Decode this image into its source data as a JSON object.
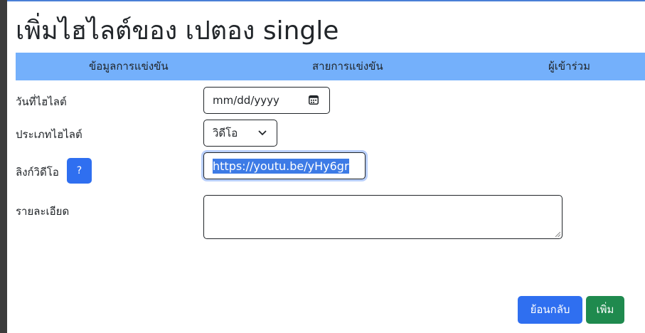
{
  "page": {
    "title": "เพิ่มไฮไลต์ของ เปตอง single"
  },
  "tabs": [
    {
      "label": "ข้อมูลการแข่งขัน"
    },
    {
      "label": "สายการแข่งขัน"
    },
    {
      "label": "ผู้เข้าร่วม"
    }
  ],
  "form": {
    "date_label": "วันที่ไฮไลต์",
    "date_placeholder": "mm/dd/yyyy",
    "type_label": "ประเภทไฮไลต์",
    "type_value": "วิดีโอ",
    "link_label": "ลิงก์วิดีโอ",
    "help_label": "?",
    "link_value": "https://youtu.be/yHy6gr",
    "detail_label": "รายละเอียด",
    "detail_value": ""
  },
  "buttons": {
    "back_label": "ย้อนกลับ",
    "add_label": "เพิ่ม"
  },
  "icons": {
    "calendar": "calendar-icon",
    "chevron": "chevron-down-icon",
    "resize": "resize-grip-icon"
  },
  "colors": {
    "nav_bg": "#74b0fb",
    "primary": "#2f6ff0",
    "success": "#1f8a4e",
    "selection": "#3d7be6"
  }
}
